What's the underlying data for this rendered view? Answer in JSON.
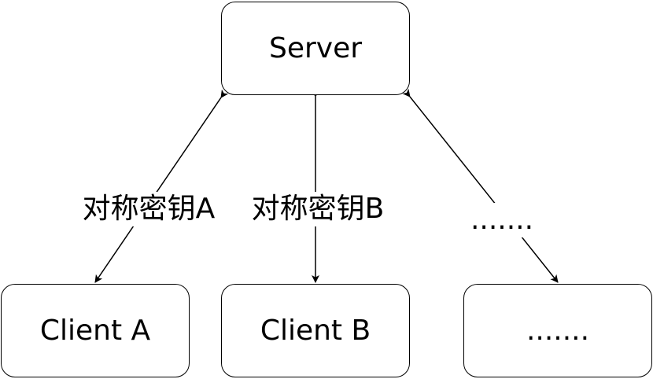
{
  "nodes": {
    "server": "Server",
    "client_a": "Client A",
    "client_b": "Client B",
    "client_c": "......."
  },
  "edges": {
    "a": "对称密钥A",
    "b": "对称密钥B",
    "c": "......."
  }
}
